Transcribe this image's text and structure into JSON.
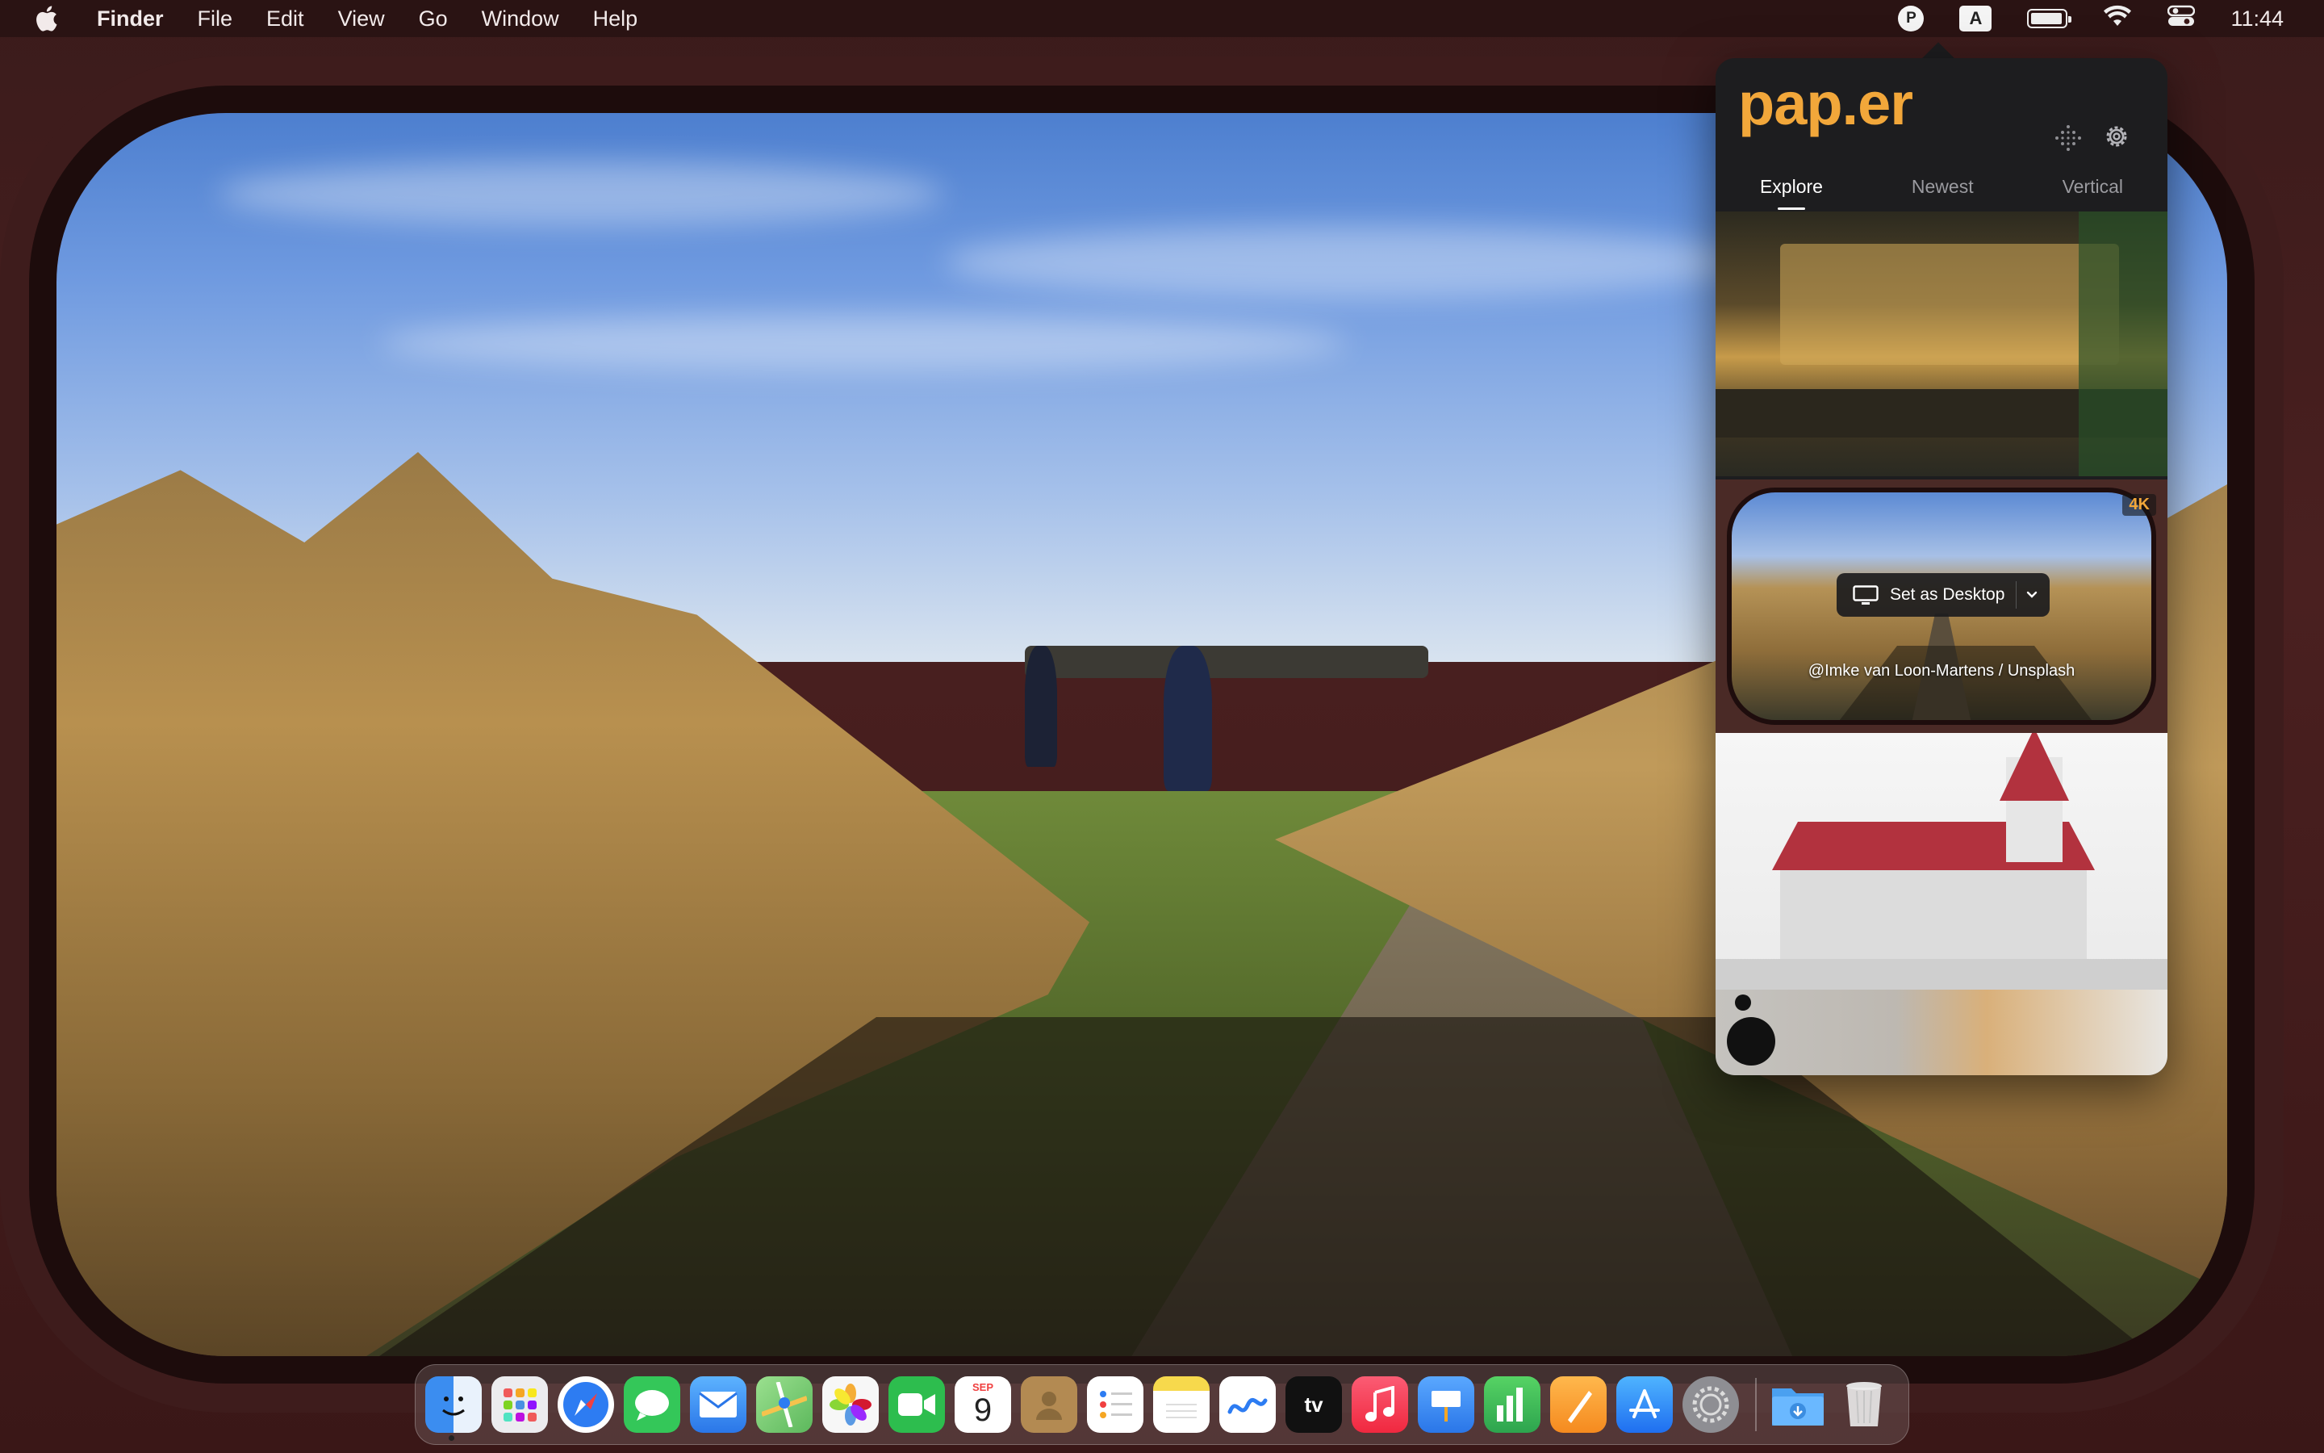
{
  "menubar": {
    "apple_icon": "apple-logo-icon",
    "app_name": "Finder",
    "items": [
      "File",
      "Edit",
      "View",
      "Go",
      "Window",
      "Help"
    ],
    "status": {
      "paper_icon_letter": "P",
      "input_source_letter": "A",
      "battery_icon": "battery-icon",
      "wifi_icon": "wifi-icon",
      "control_center_icon": "control-center-icon",
      "clock": "11:44"
    }
  },
  "paper": {
    "brand": "pap.er",
    "accent_color": "#f2a73a",
    "tabs": [
      {
        "label": "Explore",
        "active": true
      },
      {
        "label": "Newest",
        "active": false
      },
      {
        "label": "Vertical",
        "active": false
      }
    ],
    "selected": {
      "badge": "4K",
      "set_desktop_label": "Set as Desktop",
      "credit": "@Imke van Loon-Martens / Unsplash"
    }
  },
  "dock": {
    "apps": [
      {
        "name": "finder",
        "color": "#3b8df0"
      },
      {
        "name": "launchpad",
        "color": "#e8e8ec"
      },
      {
        "name": "safari",
        "color": "#2d7cf2"
      },
      {
        "name": "messages",
        "color": "#34c759"
      },
      {
        "name": "mail",
        "color": "#3a8cf5"
      },
      {
        "name": "maps",
        "color": "#68c468"
      },
      {
        "name": "photos",
        "color": "#f5f5f5"
      },
      {
        "name": "facetime",
        "color": "#2dbd4e"
      },
      {
        "name": "calendar",
        "color": "#ffffff"
      },
      {
        "name": "contacts",
        "color": "#b38a52"
      },
      {
        "name": "reminders",
        "color": "#ffffff"
      },
      {
        "name": "notes",
        "color": "#f7d94c"
      },
      {
        "name": "freeform",
        "color": "#ffffff"
      },
      {
        "name": "tv",
        "color": "#111111"
      },
      {
        "name": "music",
        "color": "#f4404f"
      },
      {
        "name": "keynote",
        "color": "#3b8df0"
      },
      {
        "name": "numbers",
        "color": "#3fbf4e"
      },
      {
        "name": "pages",
        "color": "#f59a23"
      },
      {
        "name": "app-store",
        "color": "#2f7ff5"
      },
      {
        "name": "system-settings",
        "color": "#8e8e93"
      }
    ],
    "calendar": {
      "month": "SEP",
      "day": "9"
    },
    "downloads_icon": "downloads-folder-icon",
    "trash_icon": "trash-icon"
  }
}
